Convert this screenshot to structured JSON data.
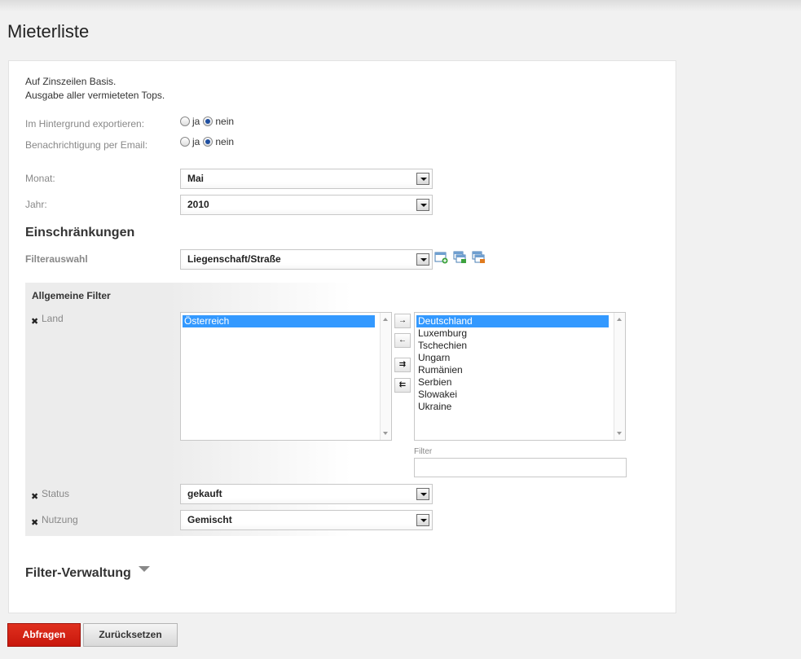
{
  "page": {
    "title": "Mieterliste"
  },
  "info": {
    "line1": "Auf Zinszeilen Basis.",
    "line2": "Ausgabe aller vermieteten Tops."
  },
  "export_background": {
    "label": "Im Hintergrund exportieren:",
    "yes": "ja",
    "no": "nein",
    "selected": "nein"
  },
  "email_notify": {
    "label": "Benachrichtigung per Email:",
    "yes": "ja",
    "no": "nein",
    "selected": "nein"
  },
  "month": {
    "label": "Monat:",
    "value": "Mai"
  },
  "year": {
    "label": "Jahr:",
    "value": "2010"
  },
  "restrictions": {
    "title": "Einschränkungen",
    "filter_select_label": "Filterauswahl",
    "filter_select_value": "Liegenschaft/Straße",
    "icons": [
      "new-filter-icon",
      "save-filter-icon",
      "delete-filter-icon"
    ]
  },
  "general_filter": {
    "title": "Allgemeine Filter",
    "land": {
      "label": "Land",
      "selected_items": [
        "Österreich"
      ],
      "available_items": [
        "Deutschland",
        "Luxemburg",
        "Tschechien",
        "Ungarn",
        "Rumänien",
        "Serbien",
        "Slowakei",
        "Ukraine"
      ],
      "available_highlighted": "Deutschland",
      "filter_label": "Filter",
      "filter_value": "",
      "move_buttons": [
        "→",
        "←",
        "⇉",
        "⇇"
      ]
    },
    "status": {
      "label": "Status",
      "value": "gekauft"
    },
    "usage": {
      "label": "Nutzung",
      "value": "Gemischt"
    }
  },
  "filter_management": {
    "title": "Filter-Verwaltung"
  },
  "actions": {
    "query": "Abfragen",
    "reset": "Zurücksetzen"
  },
  "colors": {
    "primary_button": "#d42314",
    "selection": "#3399ff"
  }
}
